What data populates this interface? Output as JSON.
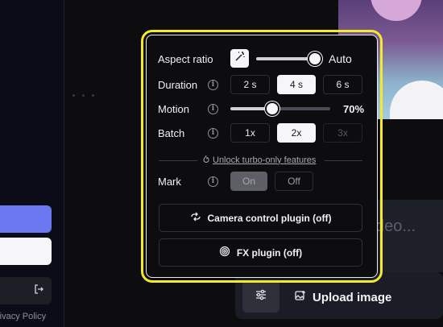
{
  "sidebar": {
    "privacy_label": "rivacy Policy",
    "logout_icon": "logout-icon"
  },
  "background": {
    "prompt_placeholder_fragment": "deo...",
    "upload_label": "Upload image",
    "settings_icon": "sliders-icon",
    "upload_icon": "image-plus-icon"
  },
  "settings": {
    "aspect_ratio": {
      "label": "Aspect ratio",
      "value_label": "Auto",
      "icon": "magic-wand-icon",
      "slider_fraction": 1.0
    },
    "duration": {
      "label": "Duration",
      "options": [
        "2 s",
        "4 s",
        "6 s"
      ],
      "selected": "4 s"
    },
    "motion": {
      "label": "Motion",
      "value_label": "70%",
      "value": 0.7
    },
    "batch": {
      "label": "Batch",
      "options": [
        "1x",
        "2x",
        "3x"
      ],
      "selected": "2x",
      "disabled": [
        "3x"
      ]
    },
    "turbo_link": "Unlock turbo-only features",
    "turbo_icon": "flame-icon",
    "mark": {
      "label": "Mark",
      "options": [
        "On",
        "Off"
      ],
      "selected": "On"
    },
    "camera_plugin": {
      "label": "Camera control plugin (off)",
      "icon": "camera-rotate-icon"
    },
    "fx_plugin": {
      "label": "FX plugin (off)",
      "icon": "spiral-icon"
    },
    "highlight_color": "#f4ea2a"
  }
}
